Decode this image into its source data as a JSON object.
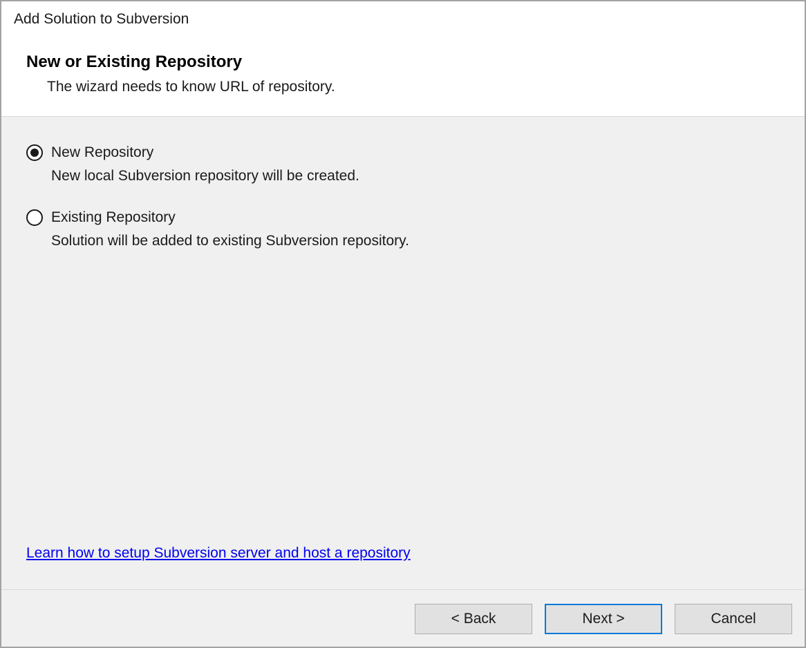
{
  "dialog": {
    "title": "Add Solution to Subversion",
    "heading": "New or Existing Repository",
    "subtitle": "The wizard needs to know URL of repository."
  },
  "options": {
    "new_repo": {
      "label": "New Repository",
      "description": "New local Subversion repository will be created.",
      "selected": true
    },
    "existing_repo": {
      "label": "Existing Repository",
      "description": "Solution will be added to existing Subversion repository.",
      "selected": false
    }
  },
  "help_link": "Learn how to setup Subversion server and host a repository",
  "buttons": {
    "back": "< Back",
    "next": "Next >",
    "cancel": "Cancel"
  }
}
